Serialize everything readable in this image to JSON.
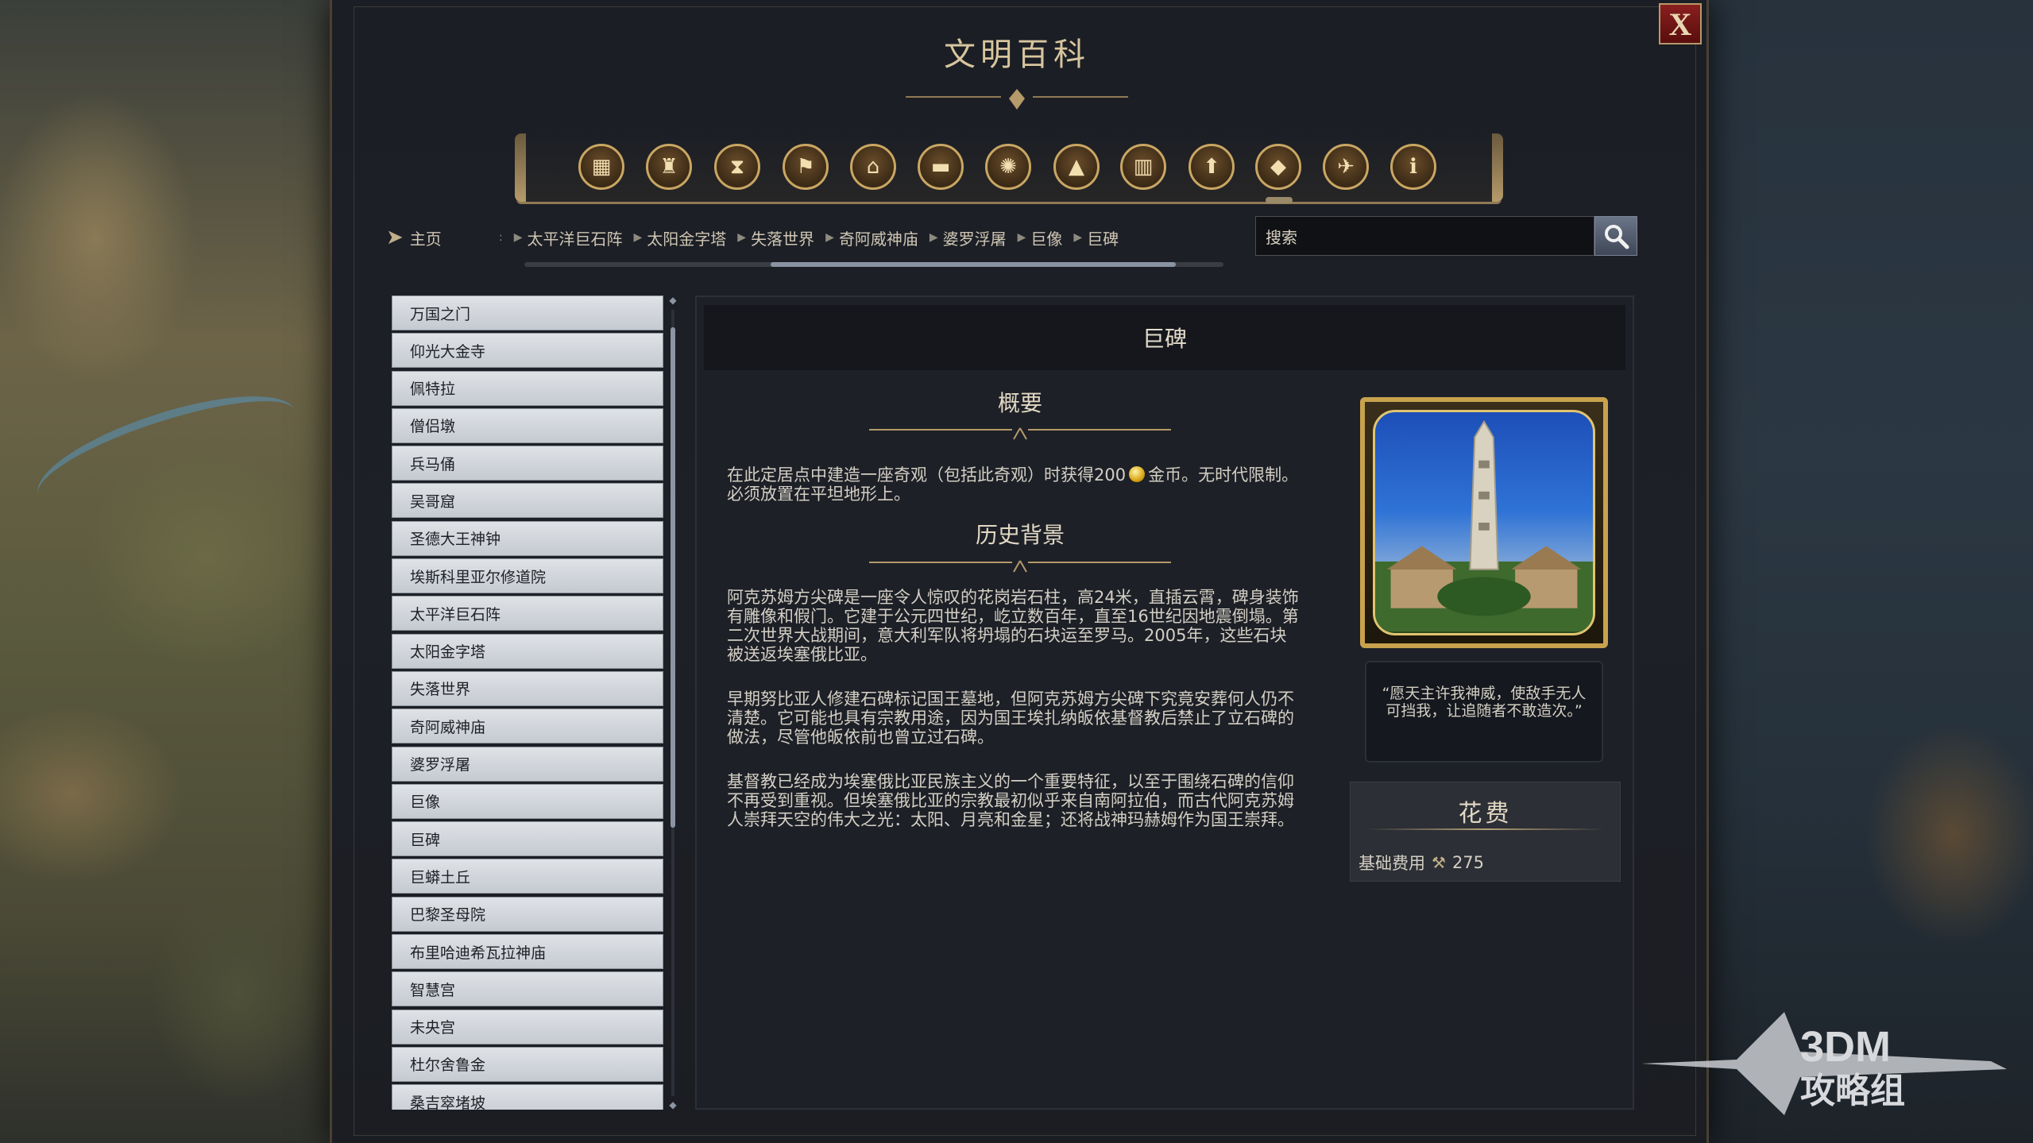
{
  "window": {
    "title": "文明百科",
    "close_label": "X"
  },
  "categories": [
    {
      "icon": "cube-icon",
      "glyph": "▦"
    },
    {
      "icon": "goblet-icon",
      "glyph": "♜"
    },
    {
      "icon": "hourglass-icon",
      "glyph": "⧗"
    },
    {
      "icon": "flag-icon",
      "glyph": "⚑"
    },
    {
      "icon": "temple-icon",
      "glyph": "⌂"
    },
    {
      "icon": "book-icon",
      "glyph": "▬"
    },
    {
      "icon": "atom-icon",
      "glyph": "✺"
    },
    {
      "icon": "mountain-icon",
      "glyph": "▲"
    },
    {
      "icon": "building-icon",
      "glyph": "▥"
    },
    {
      "icon": "up-arrow-icon",
      "glyph": "⬆"
    },
    {
      "icon": "diamond-icon",
      "glyph": "◆"
    },
    {
      "icon": "dove-icon",
      "glyph": "✈"
    },
    {
      "icon": "info-icon",
      "glyph": "ℹ"
    }
  ],
  "nav": {
    "home_label": "主页",
    "breadcrumbs": [
      "太平洋巨石阵",
      "太阳金字塔",
      "失落世界",
      "奇阿威神庙",
      "婆罗浮屠",
      "巨像",
      "巨碑"
    ],
    "search_placeholder": "搜索"
  },
  "list": [
    "万国之门",
    "仰光大金寺",
    "佩特拉",
    "僧侣墩",
    "兵马俑",
    "吴哥窟",
    "圣德大王神钟",
    "埃斯科里亚尔修道院",
    "太平洋巨石阵",
    "太阳金字塔",
    "失落世界",
    "奇阿威神庙",
    "婆罗浮屠",
    "巨像",
    "巨碑",
    "巨蟒土丘",
    "巴黎圣母院",
    "布里哈迪希瓦拉神庙",
    "智慧宫",
    "未央宫",
    "杜尔舍鲁金",
    "桑吉窣堵坡"
  ],
  "article": {
    "header": "巨碑",
    "summary_title": "概要",
    "summary_text_1": "在此定居点中建造一座奇观（包括此奇观）时获得200",
    "summary_text_2": "金币。无时代限制。必须放置在平坦地形上。",
    "history_title": "历史背景",
    "history_paragraphs": [
      "阿克苏姆方尖碑是一座令人惊叹的花岗岩石柱，高24米，直插云霄，碑身装饰有雕像和假门。它建于公元四世纪，屹立数百年，直至16世纪因地震倒塌。第二次世界大战期间，意大利军队将坍塌的石块运至罗马。2005年，这些石块被送返埃塞俄比亚。",
      "早期努比亚人修建石碑标记国王墓地，但阿克苏姆方尖碑下究竟安葬何人仍不清楚。它可能也具有宗教用途，因为国王埃扎纳皈依基督教后禁止了立石碑的做法，尽管他皈依前也曾立过石碑。",
      "基督教已经成为埃塞俄比亚民族主义的一个重要特征，以至于围绕石碑的信仰不再受到重视。但埃塞俄比亚的宗教最初似乎来自南阿拉伯，而古代阿克苏姆人崇拜天空的伟大之光：太阳、月亮和金星；还将战神玛赫姆作为国王崇拜。"
    ],
    "quote": "“愿天主许我神威，使敌手无人可挡我，让追随者不敢造次。”",
    "cost_title": "花费",
    "cost_label": "基础费用",
    "cost_value": "275"
  },
  "watermark": {
    "line1": "3DM",
    "line2": "攻略组"
  },
  "colors": {
    "gold": "#c9a663",
    "panel": "#1d2027",
    "list_item": "#d3d7dc",
    "close_red": "#8a1f1f"
  }
}
